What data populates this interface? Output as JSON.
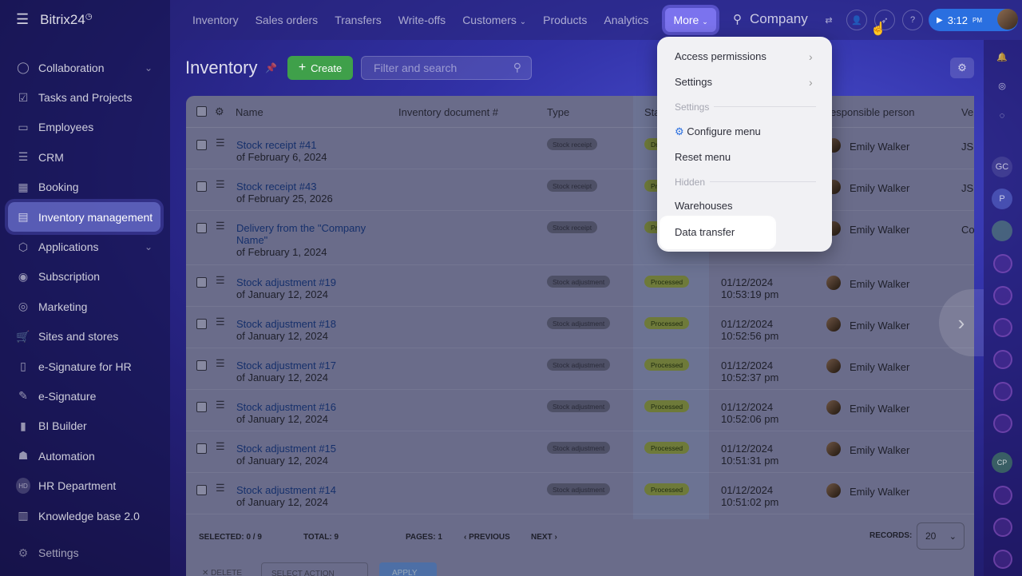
{
  "sidebar": {
    "logo": "Bitrix24",
    "logo_sup": "◷",
    "items": [
      {
        "label": "Collaboration",
        "icon": "chat-icon",
        "chevron": true
      },
      {
        "label": "Tasks and Projects",
        "icon": "checkbox-icon"
      },
      {
        "label": "Employees",
        "icon": "id-card-icon"
      },
      {
        "label": "CRM",
        "icon": "funnel-icon"
      },
      {
        "label": "Booking",
        "icon": "calendar-icon"
      },
      {
        "label": "Inventory management",
        "icon": "box-icon",
        "active": true
      },
      {
        "label": "Applications",
        "icon": "cube-icon",
        "chevron": true
      },
      {
        "label": "Subscription",
        "icon": "badge-icon"
      },
      {
        "label": "Marketing",
        "icon": "target-icon"
      },
      {
        "label": "Sites and stores",
        "icon": "cart-icon"
      },
      {
        "label": "e-Signature for HR",
        "icon": "doc-sign-icon"
      },
      {
        "label": "e-Signature",
        "icon": "pen-icon"
      },
      {
        "label": "BI Builder",
        "icon": "bar-chart-icon"
      },
      {
        "label": "Automation",
        "icon": "robot-icon"
      },
      {
        "label": "HR Department",
        "icon": "hd-badge"
      },
      {
        "label": "Knowledge base 2.0",
        "icon": "books-icon"
      }
    ],
    "settings": "Settings"
  },
  "topbar": {
    "nav": [
      "Inventory",
      "Sales orders",
      "Transfers",
      "Write-offs",
      "Customers",
      "Products",
      "Analytics"
    ],
    "customers_chevron": "⌄",
    "more": "More",
    "company": "Company",
    "time": "3:12",
    "time_suffix": "PM"
  },
  "page": {
    "title": "Inventory",
    "create": "Create",
    "filter_placeholder": "Filter and search"
  },
  "grid": {
    "columns": [
      "Name",
      "Inventory document #",
      "Type",
      "Sta",
      "esponsible person",
      "Ve"
    ],
    "rows": [
      {
        "name": "Stock receipt #41",
        "date": "of February 6, 2024",
        "type": "Stock receipt",
        "status": "Dr",
        "created": "",
        "created_time": "",
        "person": "Emily Walker",
        "extra": "JS"
      },
      {
        "name": "Stock receipt #43",
        "date": "of February 25, 2026",
        "type": "Stock receipt",
        "status": "Pr",
        "created": "",
        "created_time": "",
        "person": "Emily Walker",
        "extra": "JS"
      },
      {
        "name": "Delivery from the \"Company Name\"",
        "date": "of February 1, 2024",
        "type": "Stock receipt",
        "status": "Pr",
        "created": "",
        "created_time": "",
        "person": "Emily Walker",
        "extra": "Co Na"
      },
      {
        "name": "Stock adjustment #19",
        "date": "of January 12, 2024",
        "type": "Stock adjustment",
        "status": "Processed",
        "created": "01/12/2024",
        "created_time": "10:53:19 pm",
        "person": "Emily Walker",
        "extra": ""
      },
      {
        "name": "Stock adjustment #18",
        "date": "of January 12, 2024",
        "type": "Stock adjustment",
        "status": "Processed",
        "created": "01/12/2024",
        "created_time": "10:52:56 pm",
        "person": "Emily Walker",
        "extra": ""
      },
      {
        "name": "Stock adjustment #17",
        "date": "of January 12, 2024",
        "type": "Stock adjustment",
        "status": "Processed",
        "created": "01/12/2024",
        "created_time": "10:52:37 pm",
        "person": "Emily Walker",
        "extra": ""
      },
      {
        "name": "Stock adjustment #16",
        "date": "of January 12, 2024",
        "type": "Stock adjustment",
        "status": "Processed",
        "created": "01/12/2024",
        "created_time": "10:52:06 pm",
        "person": "Emily Walker",
        "extra": ""
      },
      {
        "name": "Stock adjustment #15",
        "date": "of January 12, 2024",
        "type": "Stock adjustment",
        "status": "Processed",
        "created": "01/12/2024",
        "created_time": "10:51:31 pm",
        "person": "Emily Walker",
        "extra": ""
      },
      {
        "name": "Stock adjustment #14",
        "date": "of January 12, 2024",
        "type": "Stock adjustment",
        "status": "Processed",
        "created": "01/12/2024",
        "created_time": "10:51:02 pm",
        "person": "Emily Walker",
        "extra": ""
      }
    ],
    "footer": {
      "selected_label": "SELECTED:",
      "selected": "0 / 9",
      "total_label": "TOTAL:",
      "total": "9",
      "pages_label": "PAGES:",
      "pages": "1",
      "previous": "PREVIOUS",
      "next": "NEXT",
      "records_label": "RECORDS:",
      "records": "20"
    },
    "actions": {
      "delete": "DELETE",
      "select_action": "SELECT ACTION",
      "apply": "APPLY"
    }
  },
  "dropdown": {
    "access_permissions": "Access permissions",
    "settings": "Settings",
    "settings_section": "Settings",
    "configure_menu": "Configure menu",
    "reset_menu": "Reset menu",
    "hidden_section": "Hidden",
    "warehouses": "Warehouses",
    "data_transfer": "Data transfer"
  },
  "rightbar": {
    "badges": [
      "GC",
      "P",
      "CP"
    ]
  },
  "colors": {
    "accent": "#7b73ee",
    "create": "#3fa04a",
    "link": "#16306b"
  }
}
